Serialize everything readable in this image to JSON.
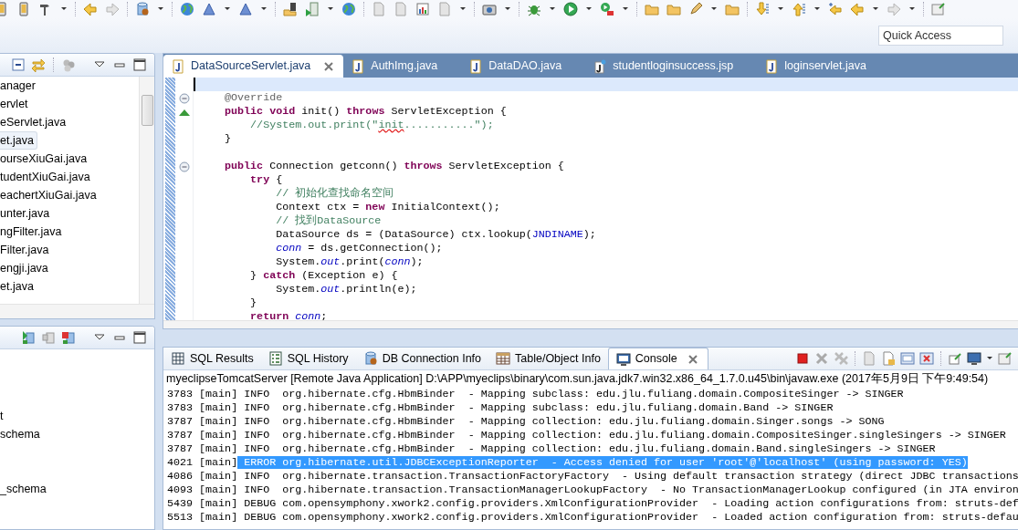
{
  "quick_access": {
    "placeholder": "Quick Access"
  },
  "package_explorer": {
    "items": [
      {
        "label": "anager",
        "selected": false
      },
      {
        "label": "ervlet",
        "selected": false
      },
      {
        "label": "eServlet.java",
        "selected": false
      },
      {
        "label": "et.java",
        "selected": true
      },
      {
        "label": "ourseXiuGai.java",
        "selected": false
      },
      {
        "label": "tudentXiuGai.java",
        "selected": false
      },
      {
        "label": "eachertXiuGai.java",
        "selected": false
      },
      {
        "label": "unter.java",
        "selected": false
      },
      {
        "label": "ngFilter.java",
        "selected": false
      },
      {
        "label": "Filter.java",
        "selected": false
      },
      {
        "label": "engji.java",
        "selected": false
      },
      {
        "label": "et.java",
        "selected": false
      }
    ]
  },
  "db_browser": {
    "items": [
      "t",
      "schema",
      "_schema"
    ]
  },
  "editor": {
    "tabs": [
      {
        "label": "DataSourceServlet.java",
        "kind": "java",
        "selected": true
      },
      {
        "label": "AuthImg.java",
        "kind": "java",
        "selected": false
      },
      {
        "label": "DataDAO.java",
        "kind": "java",
        "selected": false
      },
      {
        "label": "studentloginsuccess.jsp",
        "kind": "jsp",
        "selected": false
      },
      {
        "label": "loginservlet.java",
        "kind": "java",
        "selected": false
      }
    ],
    "lines": [
      {
        "current": true,
        "kind": "plain"
      },
      {
        "current": false,
        "kind": "fold",
        "tokens": [
          {
            "text": "    @Override",
            "kind": "annotation"
          }
        ]
      },
      {
        "current": false,
        "kind": "override",
        "tokens": [
          {
            "text": "    public",
            "kind": "keyword"
          },
          {
            "text": " void",
            "kind": "keyword"
          },
          {
            "text": " init() ",
            "kind": "plain"
          },
          {
            "text": "throws",
            "kind": "keyword"
          },
          {
            "text": " ServletException {",
            "kind": "plain"
          }
        ]
      },
      {
        "current": false,
        "kind": "plain",
        "tokens": [
          {
            "text": "        //System.out.print(\"",
            "kind": "comment"
          },
          {
            "text": "init",
            "kind": "typo"
          },
          {
            "text": "...........\");",
            "kind": "comment"
          }
        ]
      },
      {
        "current": false,
        "kind": "plain",
        "tokens": [
          {
            "text": "    }",
            "kind": "plain"
          }
        ]
      },
      {
        "current": false,
        "kind": "plain"
      },
      {
        "current": false,
        "kind": "fold",
        "tokens": [
          {
            "text": "    public",
            "kind": "keyword"
          },
          {
            "text": " Connection getconn() ",
            "kind": "plain"
          },
          {
            "text": "throws",
            "kind": "keyword"
          },
          {
            "text": " ServletException {",
            "kind": "plain"
          }
        ]
      },
      {
        "current": false,
        "kind": "plain",
        "tokens": [
          {
            "text": "        try",
            "kind": "keyword"
          },
          {
            "text": " {",
            "kind": "plain"
          }
        ]
      },
      {
        "current": false,
        "kind": "plain",
        "tokens": [
          {
            "text": "            // 初始化查找命名空间",
            "kind": "comment"
          }
        ]
      },
      {
        "current": false,
        "kind": "plain",
        "tokens": [
          {
            "text": "            Context ctx = ",
            "kind": "plain"
          },
          {
            "text": "new",
            "kind": "keyword"
          },
          {
            "text": " InitialContext();",
            "kind": "plain"
          }
        ]
      },
      {
        "current": false,
        "kind": "plain",
        "tokens": [
          {
            "text": "            // 找到DataSource",
            "kind": "comment"
          }
        ]
      },
      {
        "current": false,
        "kind": "plain",
        "tokens": [
          {
            "text": "            DataSource ds = (DataSource) ctx.lookup(",
            "kind": "plain"
          },
          {
            "text": "JNDINAME",
            "kind": "constant"
          },
          {
            "text": ");",
            "kind": "plain"
          }
        ]
      },
      {
        "current": false,
        "kind": "plain",
        "tokens": [
          {
            "text": "            conn",
            "kind": "field"
          },
          {
            "text": " = ds.getConnection();",
            "kind": "plain"
          }
        ]
      },
      {
        "current": false,
        "kind": "plain",
        "tokens": [
          {
            "text": "            System.",
            "kind": "plain"
          },
          {
            "text": "out",
            "kind": "field"
          },
          {
            "text": ".print(",
            "kind": "plain"
          },
          {
            "text": "conn",
            "kind": "field"
          },
          {
            "text": ");",
            "kind": "plain"
          }
        ]
      },
      {
        "current": false,
        "kind": "plain",
        "tokens": [
          {
            "text": "        } ",
            "kind": "plain"
          },
          {
            "text": "catch",
            "kind": "keyword"
          },
          {
            "text": " (Exception e) {",
            "kind": "plain"
          }
        ]
      },
      {
        "current": false,
        "kind": "plain",
        "tokens": [
          {
            "text": "            System.",
            "kind": "plain"
          },
          {
            "text": "out",
            "kind": "field"
          },
          {
            "text": ".println(e);",
            "kind": "plain"
          }
        ]
      },
      {
        "current": false,
        "kind": "plain",
        "tokens": [
          {
            "text": "        }",
            "kind": "plain"
          }
        ]
      },
      {
        "current": false,
        "kind": "plain",
        "tokens": [
          {
            "text": "        return",
            "kind": "keyword"
          },
          {
            "text": " conn",
            "kind": "field"
          },
          {
            "text": ";",
            "kind": "plain"
          }
        ]
      }
    ]
  },
  "bottom_panel": {
    "tabs": [
      {
        "label": "SQL Results",
        "kind": "grid",
        "selected": false
      },
      {
        "label": "SQL History",
        "kind": "list",
        "selected": false
      },
      {
        "label": "DB Connection Info",
        "kind": "database",
        "selected": false
      },
      {
        "label": "Table/Object Info",
        "kind": "table",
        "selected": false
      },
      {
        "label": "Console",
        "kind": "console",
        "selected": true
      }
    ],
    "console_title": "myeclipseTomcatServer [Remote Java Application] D:\\APP\\myeclips\\binary\\com.sun.java.jdk7.win32.x86_64_1.7.0.u45\\bin\\javaw.exe (2017年5月9日 下午9:49:54)",
    "log": [
      {
        "prefix": "3783 [main]",
        "message": "INFO  org.hibernate.cfg.HbmBinder  - Mapping subclass: edu.jlu.fuliang.domain.CompositeSinger -> SINGER",
        "selected": false
      },
      {
        "prefix": "3783 [main]",
        "message": "INFO  org.hibernate.cfg.HbmBinder  - Mapping subclass: edu.jlu.fuliang.domain.Band -> SINGER",
        "selected": false
      },
      {
        "prefix": "3787 [main]",
        "message": "INFO  org.hibernate.cfg.HbmBinder  - Mapping collection: edu.jlu.fuliang.domain.Singer.songs -> SONG",
        "selected": false
      },
      {
        "prefix": "3787 [main]",
        "message": "INFO  org.hibernate.cfg.HbmBinder  - Mapping collection: edu.jlu.fuliang.domain.CompositeSinger.singleSingers -> SINGER",
        "selected": false
      },
      {
        "prefix": "3787 [main]",
        "message": "INFO  org.hibernate.cfg.HbmBinder  - Mapping collection: edu.jlu.fuliang.domain.Band.singleSingers -> SINGER",
        "selected": false
      },
      {
        "prefix": "4021 [main]",
        "message": "ERROR org.hibernate.util.JDBCExceptionReporter  - Access denied for user 'root'@'localhost' (using password: YES)",
        "selected": true
      },
      {
        "prefix": "4086 [main]",
        "message": "INFO  org.hibernate.transaction.TransactionFactoryFactory  - Using default transaction strategy (direct JDBC transactions",
        "selected": false
      },
      {
        "prefix": "4093 [main]",
        "message": "INFO  org.hibernate.transaction.TransactionManagerLookupFactory  - No TransactionManagerLookup configured (in JTA environ",
        "selected": false
      },
      {
        "prefix": "5439 [main]",
        "message": "DEBUG com.opensymphony.xwork2.config.providers.XmlConfigurationProvider  - Loading action configurations from: struts-def",
        "selected": false
      },
      {
        "prefix": "5513 [main]",
        "message": "DEBUG com.opensymphony.xwork2.config.providers.XmlConfigurationProvider  - Loaded action configuration from: struts-defau",
        "selected": false
      }
    ]
  }
}
